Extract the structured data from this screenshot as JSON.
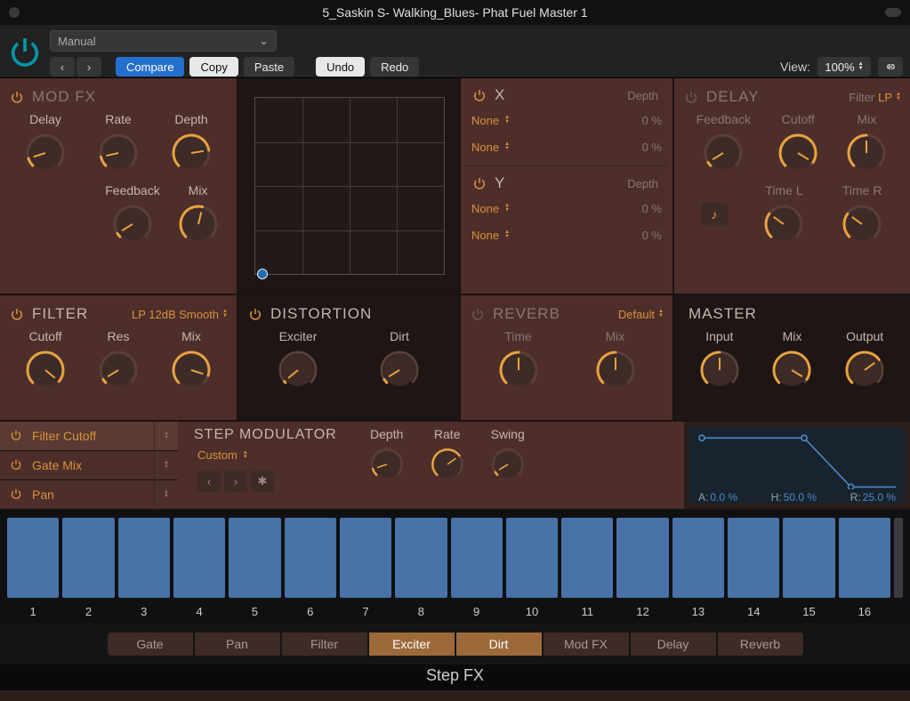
{
  "window_title": "5_Saskin S- Walking_Blues- Phat Fuel Master 1",
  "toolbar": {
    "preset": "Manual",
    "compare": "Compare",
    "copy": "Copy",
    "paste": "Paste",
    "undo": "Undo",
    "redo": "Redo",
    "view_label": "View:",
    "zoom": "100%"
  },
  "modfx": {
    "title": "MOD FX",
    "knobs1": [
      "Delay",
      "Rate",
      "Depth"
    ],
    "knobs2": [
      "Feedback",
      "Mix"
    ]
  },
  "xy": {
    "x_title": "X",
    "y_title": "Y",
    "depth_label": "Depth",
    "params": {
      "x1": {
        "name": "None",
        "val": "0 %"
      },
      "x2": {
        "name": "None",
        "val": "0 %"
      },
      "y1": {
        "name": "None",
        "val": "0 %"
      },
      "y2": {
        "name": "None",
        "val": "0 %"
      }
    }
  },
  "delay": {
    "title": "DELAY",
    "filter_label": "Filter",
    "filter_value": "LP",
    "knobs1": [
      "Feedback",
      "Cutoff",
      "Mix"
    ],
    "knobs2": [
      "Time L",
      "Time R"
    ]
  },
  "filter": {
    "title": "FILTER",
    "mode": "LP 12dB Smooth",
    "knobs": [
      "Cutoff",
      "Res",
      "Mix"
    ]
  },
  "distortion": {
    "title": "DISTORTION",
    "knobs": [
      "Exciter",
      "Dirt"
    ]
  },
  "reverb": {
    "title": "REVERB",
    "mode": "Default",
    "knobs": [
      "Time",
      "Mix"
    ]
  },
  "master": {
    "title": "MASTER",
    "knobs": [
      "Input",
      "Mix",
      "Output"
    ]
  },
  "mod_targets": [
    "Filter Cutoff",
    "Gate Mix",
    "Pan"
  ],
  "stepmod": {
    "title": "STEP MODULATOR",
    "preset": "Custom",
    "knobs": [
      "Depth",
      "Rate",
      "Swing"
    ]
  },
  "envelope": {
    "A_label": "A:",
    "A": "0.0 %",
    "H_label": "H:",
    "H": "50.0 %",
    "R_label": "R:",
    "R": "25.0 %"
  },
  "steps": {
    "count": 16,
    "labels": [
      "1",
      "2",
      "3",
      "4",
      "5",
      "6",
      "7",
      "8",
      "9",
      "10",
      "11",
      "12",
      "13",
      "14",
      "15",
      "16"
    ]
  },
  "tabs": [
    "Gate",
    "Pan",
    "Filter",
    "Exciter",
    "Dirt",
    "Mod FX",
    "Delay",
    "Reverb"
  ],
  "tabs_active": [
    3,
    4
  ],
  "plugin_name": "Step FX",
  "chart_data": {
    "type": "line",
    "title": "AHR Envelope",
    "x": [
      0,
      0.5,
      0.7,
      0.75
    ],
    "y": [
      1,
      1,
      0.25,
      0
    ],
    "xlim": [
      0,
      1
    ],
    "ylim": [
      0,
      1
    ],
    "annotations": {
      "A": "0.0 %",
      "H": "50.0 %",
      "R": "25.0 %"
    }
  }
}
